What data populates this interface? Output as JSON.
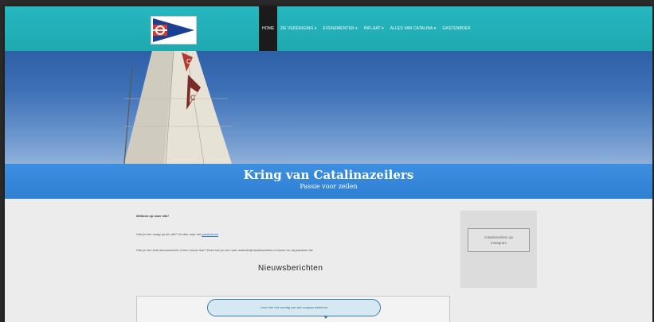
{
  "nav": {
    "items": [
      {
        "label": "HOME",
        "active": true
      },
      {
        "label": "DE VERENIGING ▾",
        "active": false
      },
      {
        "label": "EVENEMENTEN ▾",
        "active": false
      },
      {
        "label": "INFLAAT ▾",
        "active": false
      },
      {
        "label": "ALLES VAN CATALINA ▾",
        "active": false
      },
      {
        "label": "GASTENBOEK",
        "active": false
      }
    ]
  },
  "banner": {
    "title": "Kring van Catalinazeilers",
    "subtitle": "Passie voor zeilen"
  },
  "main": {
    "welcome": "Welkom op onze site!",
    "p1_text": "Heb je een vraag op de site? Ga dan naar het ",
    "p1_link": "gastenboek",
    "p2_text": "Heb je een leuk nieuwsbericht of een mooie foto? Deze kan je ook naar redactie@catalinazeilers.nl sturen en wij plaatsen die",
    "news_title": "Nieuwsberichten",
    "news_button": "Lees hier het verslag van het voorjaar weekend"
  },
  "sidebar": {
    "instagram_line1": "Catalinazeilers op",
    "instagram_line2": "Instagram"
  },
  "colors": {
    "nav": "#1fa9b1",
    "banner": "#2f7fd3",
    "active_tab": "#1b1b1b"
  }
}
